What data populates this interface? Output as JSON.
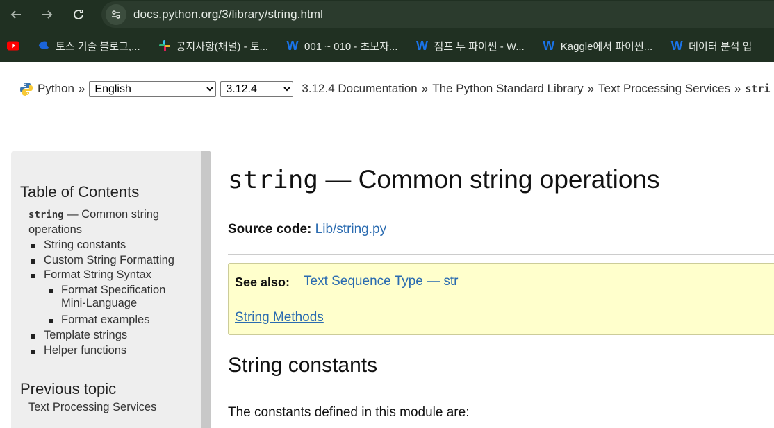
{
  "browser": {
    "url": "docs.python.org/3/library/string.html",
    "bookmarks": [
      {
        "icon": "youtube-icon",
        "label": ""
      },
      {
        "icon": "toss-icon",
        "label": "토스 기술 블로그,..."
      },
      {
        "icon": "slack-icon",
        "label": "공지사항(채널) - 토..."
      },
      {
        "icon": "wikidocs-icon",
        "label": "001 ~ 010 - 초보자..."
      },
      {
        "icon": "wikidocs-icon",
        "label": "점프 투 파이썬 - W..."
      },
      {
        "icon": "wikidocs-icon",
        "label": "Kaggle에서 파이썬..."
      },
      {
        "icon": "wikidocs-icon",
        "label": "데이터 분석 입"
      }
    ],
    "colors": {
      "chrome_bg": "#203022",
      "wikidocs": "#1a73e8"
    }
  },
  "header": {
    "python_label": "Python",
    "sep": "»",
    "language": "English",
    "version": "3.12.4",
    "breadcrumbs": [
      "3.12.4 Documentation",
      "The Python Standard Library",
      "Text Processing Services"
    ],
    "current_crumb": "stri"
  },
  "sidebar": {
    "toc_heading": "Table of Contents",
    "toc_title_code": "string",
    "toc_title_rest": " — Common string",
    "toc_title_line2": "operations",
    "items": [
      {
        "label": "String constants"
      },
      {
        "label": "Custom String Formatting"
      },
      {
        "label": "Format String Syntax"
      },
      {
        "label": "Format Specification",
        "label2": "Mini-Language"
      },
      {
        "label": "Format examples"
      },
      {
        "label": "Template strings"
      },
      {
        "label": "Helper functions"
      }
    ],
    "prev_heading": "Previous topic",
    "prev_link": "Text Processing Services"
  },
  "main": {
    "title_code": "string",
    "title_rest": " — Common string operations",
    "source_label": "Source code:",
    "source_link": "Lib/string.py",
    "see_also_label": "See also:",
    "see_also_link1": "Text Sequence Type — str",
    "see_also_link2": "String Methods",
    "section_heading": "String constants",
    "para": "The constants defined in this module are:"
  }
}
